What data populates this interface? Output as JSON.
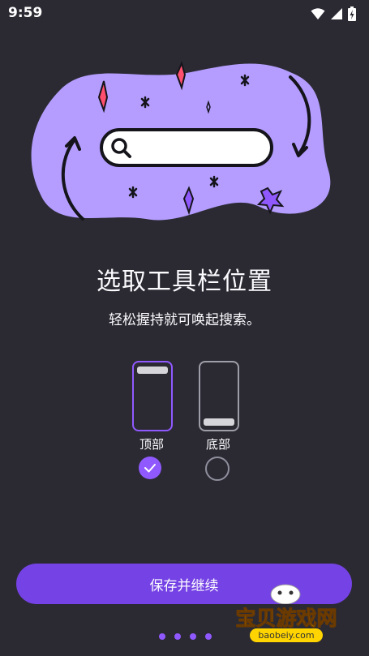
{
  "status_bar": {
    "time": "9:59"
  },
  "onboarding": {
    "title": "选取工具栏位置",
    "subtitle": "轻松握持就可唤起搜索。"
  },
  "toolbar_options": [
    {
      "label": "顶部",
      "checked": true
    },
    {
      "label": "底部",
      "checked": false
    }
  ],
  "actions": {
    "save_label": "保存并继续"
  },
  "pager": {
    "pages": 4
  },
  "watermark": {
    "text": "宝贝游戏网",
    "url": "baobeiy.com"
  },
  "colors": {
    "background": "#2b2a33",
    "accent": "#9059ff",
    "button": "#7542e5",
    "blob": "#b49dff"
  }
}
